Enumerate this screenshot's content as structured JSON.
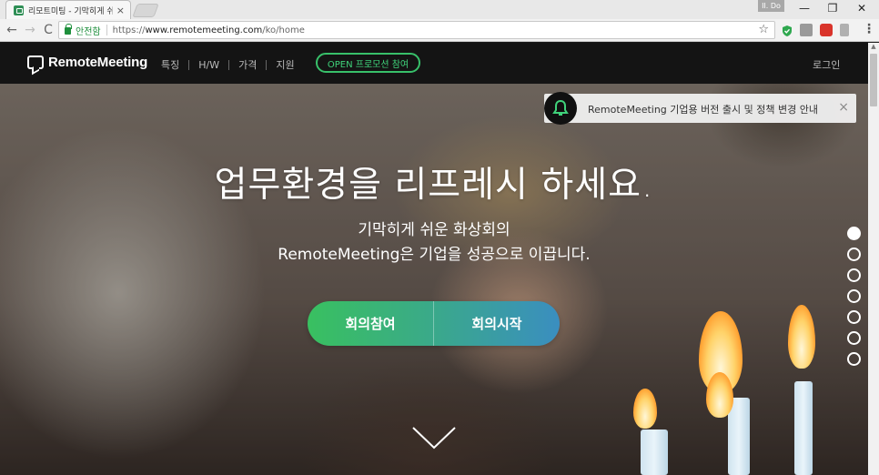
{
  "browser": {
    "tab_title": "리모트미팅 - 기막히게 쉬운 화상회의",
    "tab_close": "×",
    "user_badge": "II. Do",
    "win_minimize": "—",
    "win_restore": "❐",
    "win_close": "✕",
    "back": "←",
    "forward": "→",
    "reload": "C",
    "secure_label": "안전함",
    "url_scheme": "https://",
    "url_host": "www.remotemeeting.com",
    "url_path": "/ko/home",
    "star": "☆",
    "menu": "⋮",
    "extension_colors": [
      "#2fa84f",
      "#9a9a9a",
      "#d9342b",
      "#b0b0b0"
    ]
  },
  "header": {
    "logo_text": "RemoteMeeting",
    "nav": [
      "특징",
      "H/W",
      "가격",
      "지원"
    ],
    "promo_button": "OPEN 프로모션 참여",
    "login": "로그인"
  },
  "notice": {
    "text": "RemoteMeeting 기업용 버전 출시 및 정책 변경 안내",
    "close": "×"
  },
  "hero": {
    "headline": "업무환경을 리프레시 하세요.",
    "subline_1": "기막히게 쉬운 화상회의",
    "subline_2": "RemoteMeeting은 기업을 성공으로 이끕니다.",
    "join_button": "회의참여",
    "start_button": "회의시작",
    "slides_total": 7,
    "slide_active": 1
  },
  "colors": {
    "accent_green": "#38c06a",
    "cta_left": "#39c060",
    "cta_right": "#3a8ec0",
    "header_bg": "#141414"
  }
}
